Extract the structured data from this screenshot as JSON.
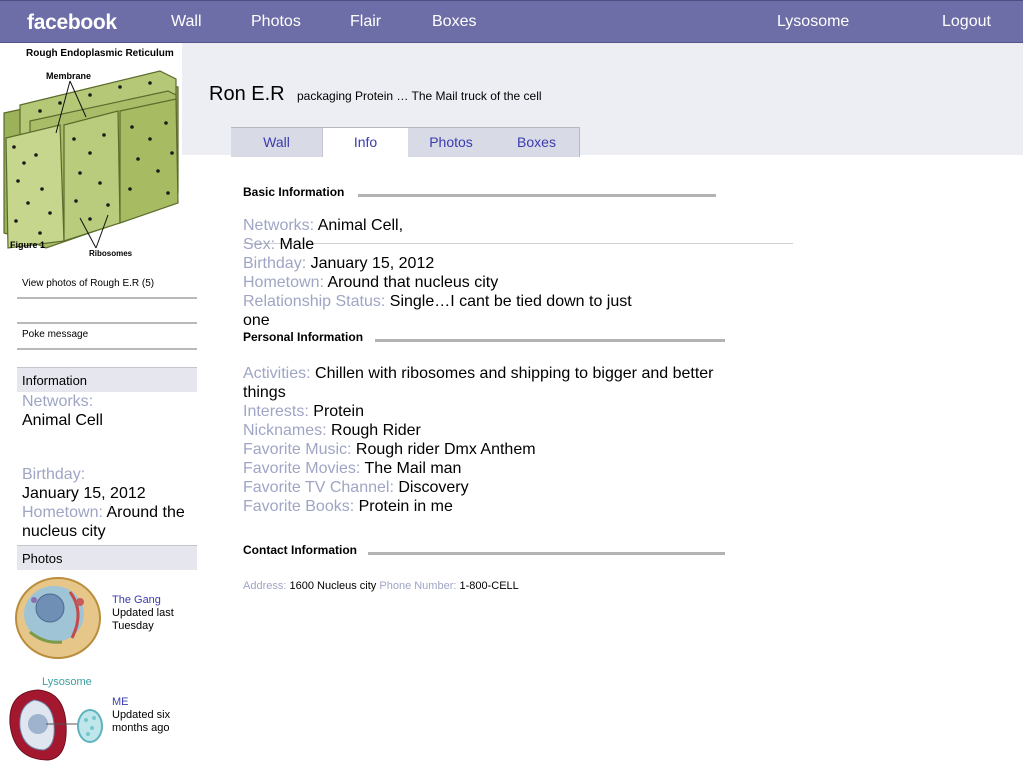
{
  "topbar": {
    "logo": "facebook",
    "nav": [
      "Wall",
      "Photos",
      "Flair",
      "Boxes"
    ],
    "user": "Lysosome",
    "logout": "Logout"
  },
  "profile": {
    "name": "Ron E.R",
    "status": "packaging Protein  … The Mail truck of the cell",
    "image": {
      "title": "Rough Endoplasmic Reticulum",
      "label_membrane": "Membrane",
      "label_figure": "Figure 1",
      "label_ribosomes": "Ribosomes"
    }
  },
  "tabs": [
    {
      "label": "Wall",
      "active": false
    },
    {
      "label": "Info",
      "active": true
    },
    {
      "label": "Photos",
      "active": false
    },
    {
      "label": "Boxes",
      "active": false
    }
  ],
  "left": {
    "view_photos": "View photos of Rough E.R (5)",
    "poke": "Poke message",
    "information_header": "Information",
    "networks_label": "Networks",
    "networks_value": "Animal Cell",
    "birthday_label": "Birthday:",
    "birthday_value": "January 15, 2012",
    "hometown_label": "Hometown:",
    "hometown_value": "Around the nucleus city",
    "photos_header": "Photos",
    "albums": [
      {
        "title": "The Gang",
        "updated": "Updated last Tuesday"
      },
      {
        "title": "ME",
        "updated": "Updated six months ago",
        "image_label": "Lysosome"
      }
    ]
  },
  "basic": {
    "header": "Basic Information",
    "networks_label": "Networks:",
    "networks_value": "Animal Cell,",
    "sex_label": "Sex:",
    "sex_value": "Male",
    "birthday_label": "Birthday:",
    "birthday_value": "January 15, 2012",
    "hometown_label": "Hometown:",
    "hometown_value": "Around that nucleus city",
    "relationship_label": "Relationship Status:",
    "relationship_value_1": "Single…I cant be tied down to just",
    "relationship_value_2": "one"
  },
  "personal": {
    "header": "Personal Information",
    "activities_label": "Activities:",
    "activities_value_1": "Chillen with ribosomes and shipping to bigger and better",
    "activities_value_2": "things",
    "interests_label": "Interests:",
    "interests_value": "Protein",
    "nicknames_label": "Nicknames:",
    "nicknames_value": "Rough Rider",
    "music_label": "Favorite Music:",
    "music_value": "Rough rider Dmx Anthem",
    "movies_label": "Favorite Movies:",
    "movies_value": "The Mail man",
    "tv_label": "Favorite TV Channel:",
    "tv_value": "Discovery",
    "books_label": "Favorite Books:",
    "books_value": "Protein in me"
  },
  "contact": {
    "header": "Contact Information",
    "address_label": "Address:",
    "address_value": "1600 Nucleus city",
    "phone_label": "Phone Number:",
    "phone_value": "1-800-CELL"
  },
  "colors": {
    "topbar": "#6d6da7",
    "band": "#eceef4",
    "label": "#9fa5c4",
    "link": "#3b3bb0"
  }
}
